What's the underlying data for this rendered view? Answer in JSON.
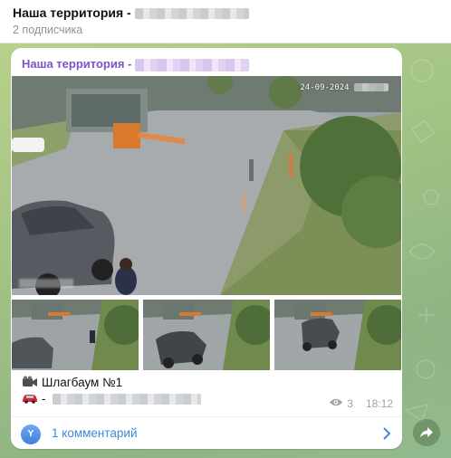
{
  "header": {
    "title": "Наша территория -",
    "subscribers": "2 подписчика"
  },
  "message": {
    "author": "Наша территория -",
    "camera_timestamp": "24-09-2024",
    "caption_line1": "Шлагбаум №1",
    "caption_line2": "-",
    "views": "3",
    "time": "18:12",
    "comments_label": "1 комментарий",
    "comment_avatar_letter": "Y"
  },
  "icons": {
    "camera": "video-camera-icon",
    "car": "red-car-icon",
    "views": "eye-icon",
    "chevron": "chevron-right-icon",
    "share": "share-arrow-icon"
  },
  "colors": {
    "author": "#7b54c9",
    "link": "#3a8ad9",
    "meta": "#9aa4ab"
  }
}
